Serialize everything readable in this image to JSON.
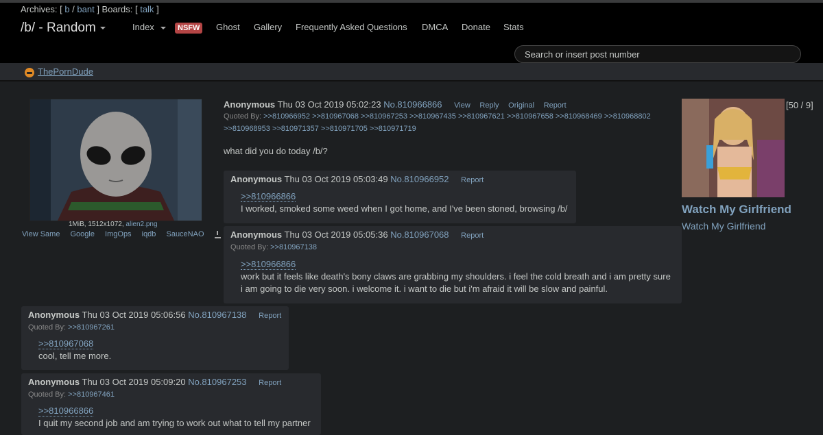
{
  "header": {
    "archives_label": "Archives: [",
    "archive_links": [
      "b",
      "bant"
    ],
    "boards_label": "] Boards: [",
    "board_links": [
      "talk"
    ],
    "close_bracket": "]",
    "board_title": "/b/ - Random",
    "nav": {
      "index": "Index",
      "nsfw_badge": "NSFW",
      "ghost": "Ghost",
      "gallery": "Gallery",
      "faq": "Frequently Asked Questions",
      "dmca": "DMCA",
      "donate": "Donate",
      "stats": "Stats"
    },
    "search_placeholder": "Search or insert post number"
  },
  "sponsor": {
    "label": "ThePornDude"
  },
  "op": {
    "file_size": "1MiB, 1512x1072,",
    "file_name": "alien2.png",
    "image_tools": [
      "View Same",
      "Google",
      "ImgOps",
      "iqdb",
      "SauceNAO"
    ],
    "name": "Anonymous",
    "date": "Thu 03 Oct 2019 05:02:23",
    "number": "No.810966866",
    "actions": [
      "View",
      "Reply",
      "Original",
      "Report"
    ],
    "quoted_by_label": "Quoted By:",
    "quoted_by_line1": ">>810966952 >>810967068 >>810967253 >>810967435 >>810967621 >>810967658 >>810968469 >>810968802",
    "quoted_by_line2": ">>810968953 >>810971357 >>810971705 >>810971719",
    "text": "what did you do today /b/?"
  },
  "replies": [
    {
      "name": "Anonymous",
      "date": "Thu 03 Oct 2019 05:03:49",
      "number": "No.810966952",
      "report": "Report",
      "quoted_by": "",
      "quote_link": ">>810966866",
      "lines": [
        "I worked, smoked some weed when I got home, and I've been stoned, browsing /b/"
      ]
    },
    {
      "name": "Anonymous",
      "date": "Thu 03 Oct 2019 05:05:36",
      "number": "No.810967068",
      "report": "Report",
      "quoted_by": ">>810967138",
      "quote_link": ">>810966866",
      "lines": [
        "work but it feels like death's bony claws are grabbing my shoulders. i feel the cold breath and i am pretty sure",
        "i am going to die very soon. i welcome it. i want to die but i'm afraid it will be slow and painful."
      ]
    },
    {
      "name": "Anonymous",
      "date": "Thu 03 Oct 2019 05:06:56",
      "number": "No.810967138",
      "report": "Report",
      "quoted_by": ">>810967261",
      "quote_link": ">>810967068",
      "lines": [
        "cool, tell me more."
      ]
    },
    {
      "name": "Anonymous",
      "date": "Thu 03 Oct 2019 05:09:20",
      "number": "No.810967253",
      "report": "Report",
      "quoted_by": ">>810967461",
      "quote_link": ">>810966866",
      "lines": [
        "I quit my second job and am trying to work out what to tell my partner"
      ]
    }
  ],
  "ad": {
    "counter": "[50 / 9]",
    "title": "Watch My Girlfriend",
    "subtitle": "Watch My Girlfriend"
  }
}
